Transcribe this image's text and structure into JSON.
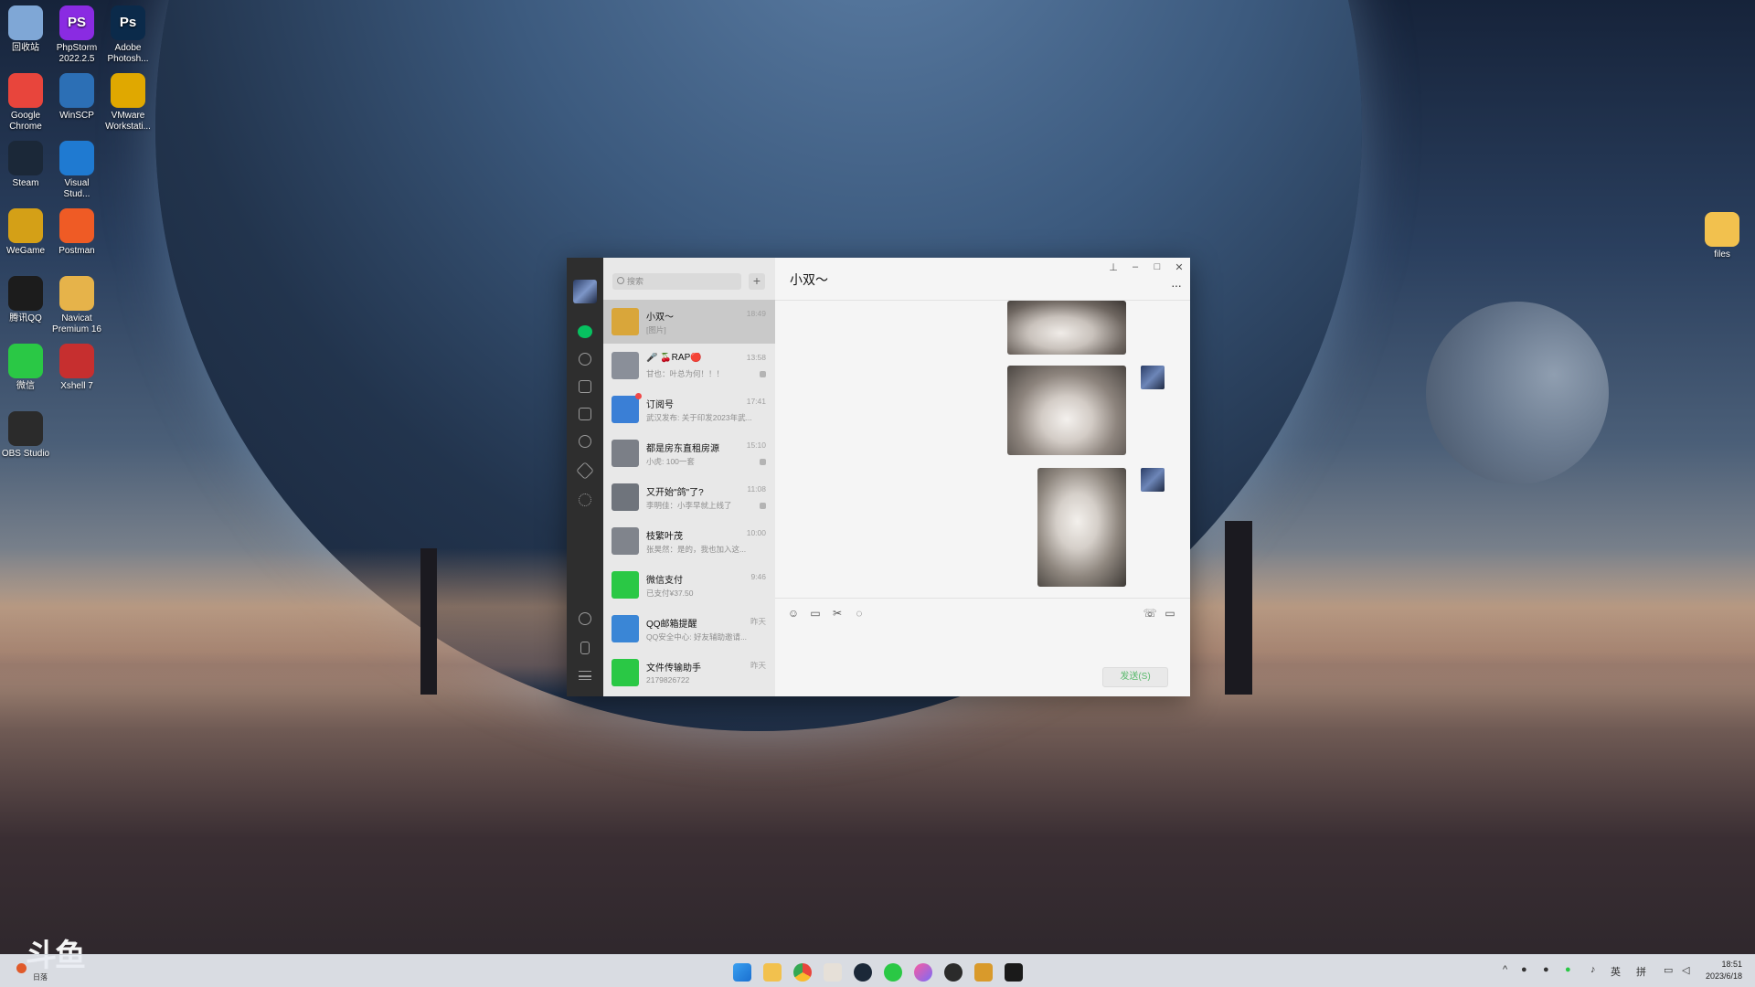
{
  "desktop": {
    "icons": [
      {
        "label": "回收站",
        "icon": "recycle-bin-icon",
        "color": "#7fa7d6"
      },
      {
        "label": "PhpStorm 2022.2.5",
        "icon": "phpstorm-icon",
        "color": "#8a2be2",
        "glyph": "PS"
      },
      {
        "label": "Adobe Photosh...",
        "icon": "photoshop-icon",
        "color": "#0b2a4a",
        "glyph": "Ps"
      },
      {
        "label": "Google Chrome",
        "icon": "chrome-icon",
        "color": "#e8453c"
      },
      {
        "label": "WinSCP",
        "icon": "winscp-icon",
        "color": "#2c6fb5"
      },
      {
        "label": "VMware Workstati...",
        "icon": "vmware-icon",
        "color": "#e0a800"
      },
      {
        "label": "Steam",
        "icon": "steam-icon",
        "color": "#1b2838"
      },
      {
        "label": "Visual Stud...",
        "icon": "vscode-icon",
        "color": "#1f7ad1"
      },
      {
        "label": "WeGame",
        "icon": "wegame-icon",
        "color": "#d4a017"
      },
      {
        "label": "Postman",
        "icon": "postman-icon",
        "color": "#ef5b25"
      },
      {
        "label": "腾讯QQ",
        "icon": "qq-icon",
        "color": "#1c1c1c"
      },
      {
        "label": "Navicat Premium 16",
        "icon": "navicat-icon",
        "color": "#e6b34a"
      },
      {
        "label": "微信",
        "icon": "wechat-icon",
        "color": "#2ac845"
      },
      {
        "label": "Xshell 7",
        "icon": "xshell-icon",
        "color": "#c62f2f"
      },
      {
        "label": "OBS Studio",
        "icon": "obs-icon",
        "color": "#2b2b2b"
      },
      {
        "label": "files",
        "icon": "folder-icon",
        "color": "#f2c14e"
      }
    ]
  },
  "wechat": {
    "search": {
      "placeholder": "搜索"
    },
    "add_label": "+",
    "chats": [
      {
        "name": "小双～",
        "preview": "[图片]",
        "time": "18:49",
        "active": true,
        "avatar_color": "#d9a63a"
      },
      {
        "name": "🎤 🍒RAP🔴",
        "preview": "甘也：叶总为何！！！",
        "time": "13:58",
        "muted": true,
        "avatar_color": "#8a8f99"
      },
      {
        "name": "订阅号",
        "preview": "武汉发布: 关于印发2023年武...",
        "time": "17:41",
        "unread_dot": true,
        "avatar_color": "#3a7fd6"
      },
      {
        "name": "都是房东直租房源",
        "preview": "小虎: 100一套",
        "time": "15:10",
        "muted": true,
        "avatar_color": "#7b7f87"
      },
      {
        "name": "又开始\"鸽\"了?",
        "preview": "李明佳：小李早就上线了",
        "time": "11:08",
        "muted": true,
        "avatar_color": "#6f747c"
      },
      {
        "name": "枝繁叶茂",
        "preview": "张昊然：是的，我也加入这...",
        "time": "10:00",
        "avatar_color": "#80848c"
      },
      {
        "name": "微信支付",
        "preview": "已支付¥37.50",
        "time": "9:46",
        "avatar_color": "#2ac845"
      },
      {
        "name": "QQ邮箱提醒",
        "preview": "QQ安全中心: 好友辅助邀请...",
        "time": "昨天",
        "avatar_color": "#3a86d6"
      },
      {
        "name": "文件传输助手",
        "preview": "2179826722",
        "time": "昨天",
        "avatar_color": "#2ac845"
      }
    ],
    "conversation": {
      "title": "小双～",
      "more": "···",
      "send_label": "发送(S)"
    }
  },
  "taskbar": {
    "weather": "日落",
    "tray_lang": "英",
    "tray_ime": "拼",
    "clock_time": "18:51",
    "clock_date": "2023/6/18"
  },
  "watermark": "斗鱼"
}
